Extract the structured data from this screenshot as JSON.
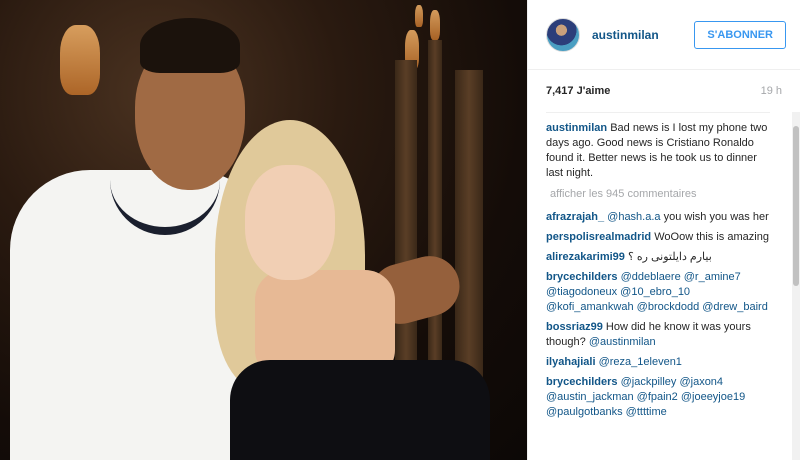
{
  "post": {
    "username": "austinmilan",
    "follow_label": "S'ABONNER",
    "likes": "7,417 J'aime",
    "time": "19 h",
    "caption": "Bad news is I lost my phone two days ago. Good news is Cristiano Ronaldo found it. Better news is he took us to dinner last night.",
    "more_comments": "afficher les 945 commentaires"
  },
  "comments": [
    {
      "user": "afrazrajah_",
      "mention": "@hash.a.a",
      "text": " you wish you was her"
    },
    {
      "user": "perspolisrealmadrid",
      "mention": "",
      "text": " WoOow this is amazing"
    },
    {
      "user": "alirezakarimi99",
      "mention": "",
      "text": "بیارم دایلتونی ره ؟"
    },
    {
      "user": "brycechilders",
      "mention": "@ddeblaere @r_amine7 @tiagodoneux @10_ebro_10 @kofi_amankwah @brockdodd @drew_baird",
      "text": ""
    },
    {
      "user": "bossriaz99",
      "mention": "",
      "text": " How did he know it was yours though? ",
      "mention2": "@austinmilan"
    },
    {
      "user": "ilyahajiali",
      "mention": "@reza_1eleven1",
      "text": ""
    },
    {
      "user": "brycechilders",
      "mention": "@jackpilley @jaxon4 @austin_jackman @fpain2 @joeeyjoe19 @paulgotbanks @ttttime",
      "text": ""
    }
  ],
  "colors": {
    "link": "#125688",
    "follow": "#3897f0",
    "muted": "#a5a7aa"
  },
  "icons": {
    "avatar": "user-avatar"
  }
}
